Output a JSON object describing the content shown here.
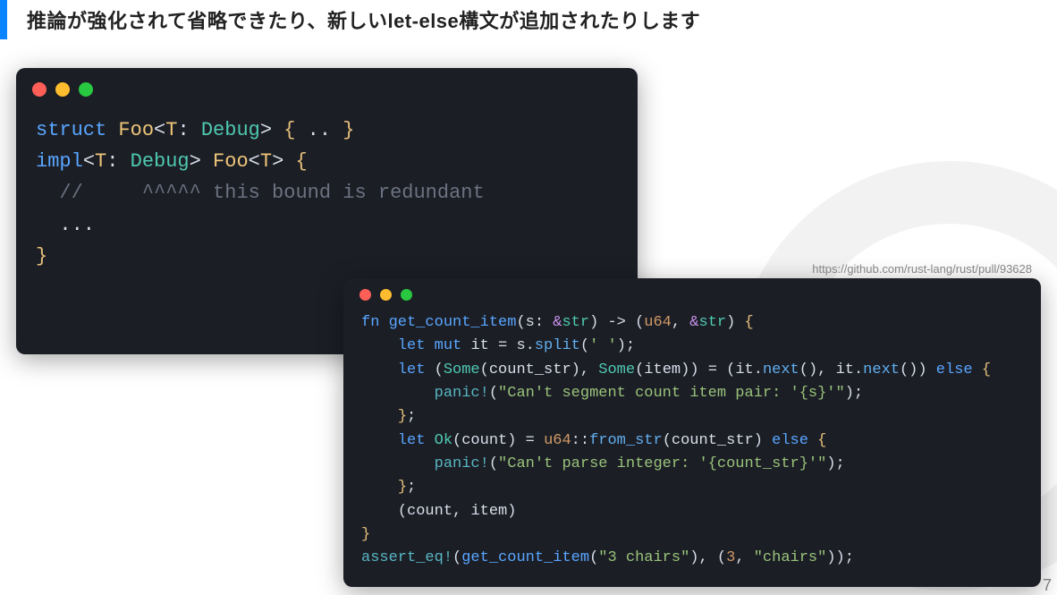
{
  "heading": "推論が強化されて省略できたり、新しいlet-else構文が追加されたりします",
  "url": "https://github.com/rust-lang/rust/pull/93628",
  "page_number": "7",
  "code1": {
    "line1": {
      "kw_struct": "struct",
      "sp1": " ",
      "ty_foo": "Foo",
      "lt": "<",
      "ty_t": "T",
      "colon": ": ",
      "trait": "Debug",
      "gt": ">",
      "sp2": " ",
      "lb": "{",
      "dots": " .. ",
      "rb": "}"
    },
    "line2": {
      "kw_impl": "impl",
      "lt": "<",
      "ty_t": "T",
      "colon": ": ",
      "trait": "Debug",
      "gt": ">",
      "sp": " ",
      "ty_foo": "Foo",
      "lt2": "<",
      "ty_t2": "T",
      "gt2": ">",
      "sp2": " ",
      "lb": "{"
    },
    "line3": {
      "indent": "  ",
      "slashes": "//",
      "spaces": "     ",
      "carets": "^^^^^",
      "sp": " ",
      "msg": "this bound is redundant"
    },
    "line4": {
      "indent": "  ",
      "dots": "..."
    },
    "line5": {
      "rb": "}"
    }
  },
  "code2": {
    "l1": {
      "kw_fn": "fn",
      "sp": " ",
      "fn": "get_count_item",
      "lp": "(",
      "arg": "s",
      "colon": ": ",
      "amp": "&",
      "str_t": "str",
      "rp": ")",
      "arrow": " -> ",
      "lp2": "(",
      "u64": "u64",
      "comma": ", ",
      "amp2": "&",
      "str_t2": "str",
      "rp2": ")",
      "sp2": " ",
      "lb": "{"
    },
    "l2": {
      "indent": "    ",
      "kw_let": "let",
      "sp": " ",
      "kw_mut": "mut",
      "sp2": " ",
      "var": "it",
      "eq": " = ",
      "s": "s",
      "dot": ".",
      "method": "split",
      "lp": "(",
      "q1": "'",
      "ch": " ",
      "q2": "'",
      "rp": ")",
      "semi": ";"
    },
    "l3": {
      "indent": "    ",
      "kw_let": "let",
      "sp": " ",
      "lp": "(",
      "some1": "Some",
      "lp1": "(",
      "v1": "count_str",
      "rp1": ")",
      "comma": ", ",
      "some2": "Some",
      "lp2": "(",
      "v2": "item",
      "rp2": ")",
      "rp": ")",
      "eq": " = ",
      "lp3": "(",
      "it1": "it",
      "dot1": ".",
      "next1": "next",
      "call1": "()",
      "comma2": ", ",
      "it2": "it",
      "dot2": ".",
      "next2": "next",
      "call2": "()",
      "rp3": ")",
      "sp2": " ",
      "kw_else": "else",
      "sp3": " ",
      "lb": "{"
    },
    "l4": {
      "indent": "        ",
      "panic": "panic!",
      "lp": "(",
      "s": "\"Can't segment count item pair: '{s}'\"",
      "rp": ")",
      "semi": ";"
    },
    "l5": {
      "indent": "    ",
      "rb": "}",
      "semi": ";"
    },
    "l6": {
      "indent": "    ",
      "kw_let": "let",
      "sp": " ",
      "ok": "Ok",
      "lp": "(",
      "v": "count",
      "rp": ")",
      "eq": " = ",
      "u64": "u64",
      "cc": "::",
      "fr": "from_str",
      "lp2": "(",
      "arg": "count_str",
      "rp2": ")",
      "sp2": " ",
      "kw_else": "else",
      "sp3": " ",
      "lb": "{"
    },
    "l7": {
      "indent": "        ",
      "panic": "panic!",
      "lp": "(",
      "s": "\"Can't parse integer: '{count_str}'\"",
      "rp": ")",
      "semi": ";"
    },
    "l8": {
      "indent": "    ",
      "rb": "}",
      "semi": ";"
    },
    "l9": {
      "indent": "    ",
      "lp": "(",
      "v1": "count",
      "comma": ", ",
      "v2": "item",
      "rp": ")"
    },
    "l10": {
      "rb": "}"
    },
    "l11": {
      "assert": "assert_eq!",
      "lp": "(",
      "fn": "get_count_item",
      "lp2": "(",
      "s": "\"3 chairs\"",
      "rp2": ")",
      "comma": ", ",
      "lp3": "(",
      "n": "3",
      "comma2": ", ",
      "s2": "\"chairs\"",
      "rp3": ")",
      "rp": ")",
      "semi": ";"
    }
  }
}
